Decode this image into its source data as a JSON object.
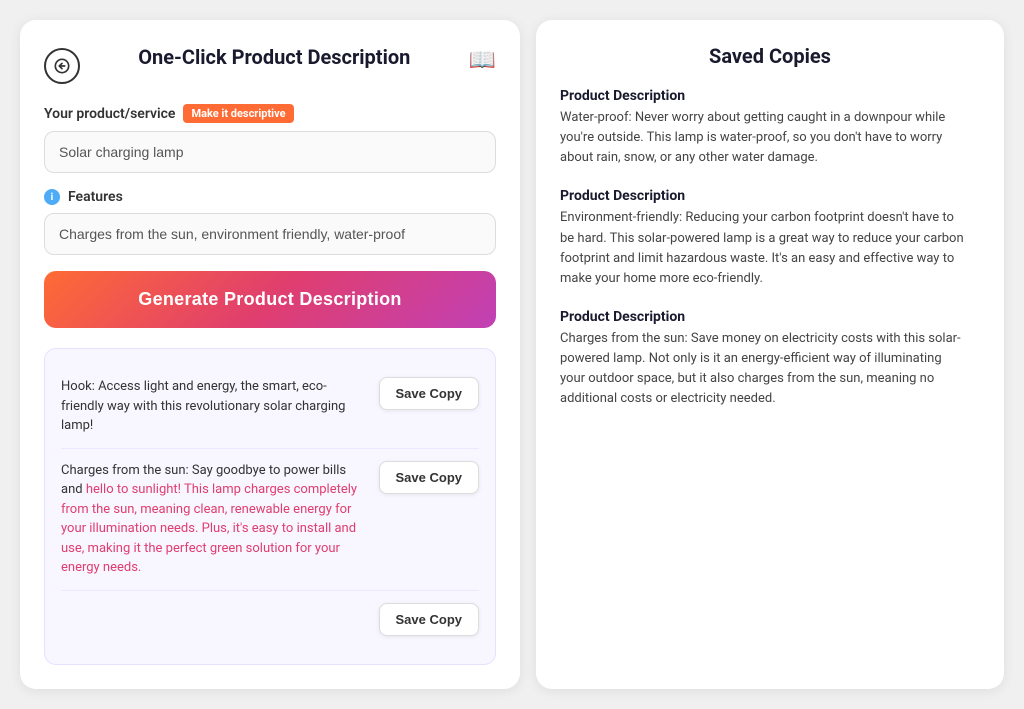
{
  "left": {
    "title": "One-Click Product Description",
    "book_icon": "📖",
    "product_label": "Your product/service",
    "make_it_label": "Make it descriptive",
    "product_placeholder": "Solar charging lamp",
    "features_label": "Features",
    "info_icon": "i",
    "features_placeholder": "Charges from the sun, environment friendly, water-proof",
    "generate_btn": "Generate Product Description",
    "copies": [
      {
        "text": "Hook: Access light and energy, the smart, eco-friendly way with this revolutionary solar charging lamp!",
        "highlight": false,
        "save_btn": "Save Copy"
      },
      {
        "text_before": "Charges from the sun: Say goodbye to power bills and hello to sunlight! This lamp charges completely from the sun, meaning clean, renewable energy for your illumination needs. Plus, it's easy to install and use, making it the perfect green solution for your energy needs.",
        "highlight": "hello to sunlight! This lamp charges completely from the sun, meaning clean, renewable energy for your illumination needs. Plus, it's easy to install and use, making it the perfect green solution for your energy needs.",
        "save_btn": "Save Copy"
      },
      {
        "text": "Save Copy",
        "save_btn": "Save Copy"
      }
    ]
  },
  "right": {
    "title": "Saved Copies",
    "items": [
      {
        "title": "Product Description",
        "text": "Water-proof: Never worry about getting caught in a downpour while you're outside. This lamp is water-proof, so you don't have to worry about rain, snow, or any other water damage."
      },
      {
        "title": "Product Description",
        "text": "Environment-friendly: Reducing your carbon footprint doesn't have to be hard. This solar-powered lamp is a great way to reduce your carbon footprint and limit hazardous waste. It's an easy and effective way to make your home more eco-friendly."
      },
      {
        "title": "Product Description",
        "text": "Charges from the sun: Save money on electricity costs with this solar-powered lamp. Not only is it an energy-efficient way of illuminating your outdoor space, but it also charges from the sun, meaning no additional costs or electricity needed."
      }
    ]
  }
}
